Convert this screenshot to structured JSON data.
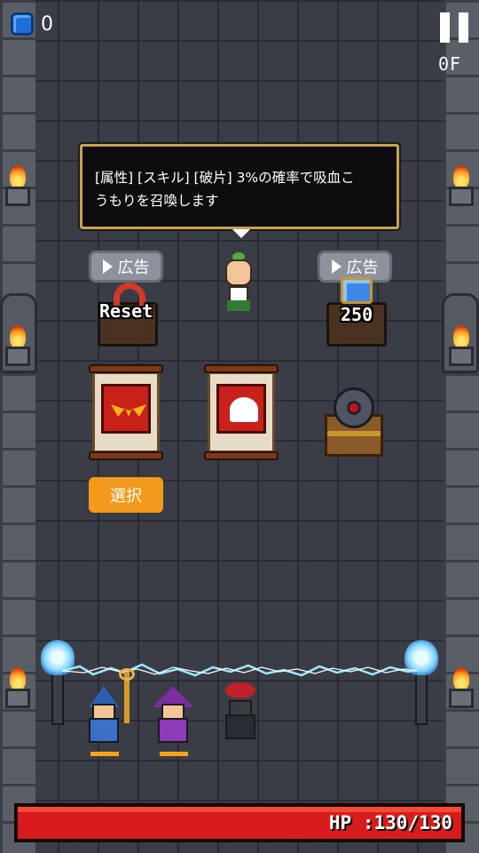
{
  "hud": {
    "gem_count": "0",
    "floor": "0F",
    "pause_icon": "pause-icon",
    "gem_icon": "blue-gem-icon"
  },
  "tooltip": {
    "line1": "[属性] [スキル] [破片] 3%の確率で吸血こ",
    "line2": "うもりを召喚します"
  },
  "shop": {
    "ad_left_label": "広告",
    "ad_right_label": "広告",
    "ad_icon": "play-icon",
    "reset_label": "Reset",
    "gem_price": "250",
    "select_label": "選択"
  },
  "items": [
    {
      "name": "bat-wings-scroll",
      "icon": "bat-wings-icon"
    },
    {
      "name": "ghost-scroll",
      "icon": "ghost-icon"
    },
    {
      "name": "cannon-on-chest",
      "icon": "cannon-icon"
    }
  ],
  "player": {
    "hp_text": "HP :130/130",
    "hp_current": 130,
    "hp_max": 130
  },
  "colors": {
    "accent_orange": "#f39a1c",
    "hp_red": "#d61c1c",
    "tooltip_border": "#c9a24b",
    "gem_blue": "#1e6fd9"
  }
}
